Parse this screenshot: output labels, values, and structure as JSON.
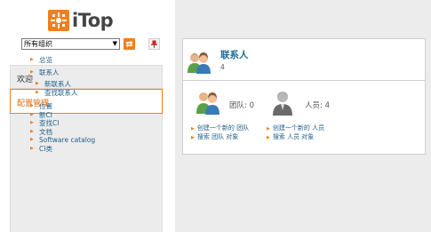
{
  "logo": {
    "text": "iTop"
  },
  "org_selector": {
    "value": "所有组织"
  },
  "menu": {
    "welcome": "欢迎",
    "config": "配置管理",
    "tree": {
      "overview": "总览",
      "contacts": "联系人",
      "new_contact": "新联系人",
      "search_contacts": "查找联系人",
      "locations": "位置",
      "new_ci": "新CI",
      "search_ci": "查找CI",
      "documents": "文档",
      "software_catalog": "Software catalog",
      "ci_types": "CI类"
    }
  },
  "panel": {
    "title": "联系人",
    "count": "4",
    "teams": {
      "label": "团队: 0",
      "create": "创建一个新的 团队",
      "search": "搜索 团队 对象"
    },
    "persons": {
      "label": "人员: 4",
      "create": "创建一个新的 人员",
      "search": "搜索 人员 对象"
    }
  },
  "colors": {
    "accent": "#f07f1e",
    "link": "#1d5f8c",
    "title": "#1d6b9c",
    "pane_bg": "#ececec"
  },
  "icons": [
    "itop-logo-icon",
    "chevron-down-icon",
    "org-go-icon",
    "pin-icon",
    "contacts-icon",
    "team-icon",
    "person-icon",
    "bullet-icon"
  ]
}
